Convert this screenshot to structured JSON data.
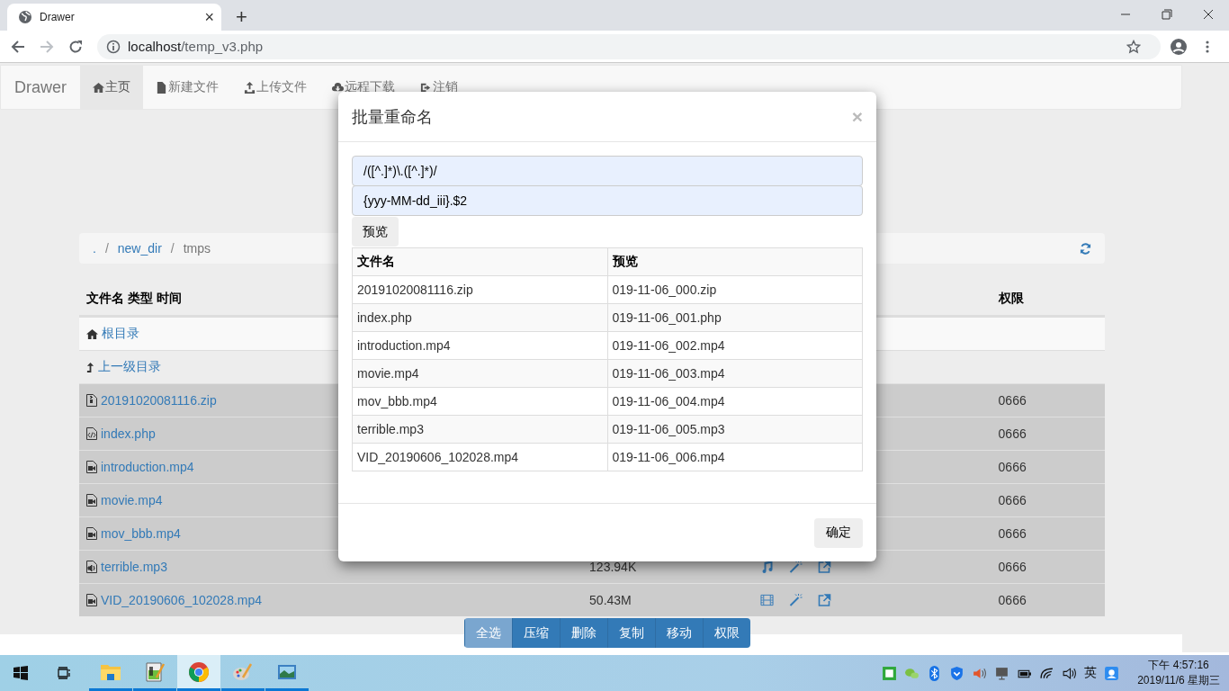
{
  "browser": {
    "tab": {
      "title": "Drawer",
      "close": "×"
    },
    "new_tab": "+",
    "url": {
      "host": "localhost",
      "path": "/temp_v3.php"
    },
    "forward_disabled": true
  },
  "navbar": {
    "brand": "Drawer",
    "items": [
      {
        "kind": "home",
        "label": "主页",
        "selected": true
      },
      {
        "kind": "file",
        "label": "新建文件",
        "selected": false
      },
      {
        "kind": "upload",
        "label": "上传文件",
        "selected": false
      },
      {
        "kind": "download",
        "label": "远程下载",
        "selected": false
      },
      {
        "kind": "logout",
        "label": "注销",
        "selected": false
      }
    ]
  },
  "breadcrumb": [
    {
      "label": ".",
      "current": false,
      "separator": "/"
    },
    {
      "label": "new_dir",
      "current": false,
      "separator": "/"
    },
    {
      "label": "tmps",
      "current": true
    }
  ],
  "file_table": {
    "header": {
      "name": "文件名 类型 时间",
      "permissions": "权限"
    },
    "nav_rows": [
      {
        "kind": "root",
        "label": "根目录"
      },
      {
        "kind": "up",
        "label": "上一级目录"
      }
    ],
    "rows": [
      {
        "kind": "zip",
        "name": "20191020081116.zip",
        "selected": true,
        "permissions": "0666"
      },
      {
        "kind": "code",
        "name": "index.php",
        "selected": true,
        "permissions": "0666"
      },
      {
        "kind": "video",
        "name": "introduction.mp4",
        "selected": true,
        "permissions": "0666"
      },
      {
        "kind": "video",
        "name": "movie.mp4",
        "selected": true,
        "permissions": "0666"
      },
      {
        "kind": "video",
        "name": "mov_bbb.mp4",
        "selected": true,
        "permissions": "0666"
      },
      {
        "kind": "audio",
        "name": "terrible.mp3",
        "selected": true,
        "size": "123.94K",
        "actions": [
          {
            "kind": "music"
          },
          {
            "kind": "rename"
          },
          {
            "kind": "open"
          }
        ],
        "permissions": "0666"
      },
      {
        "kind": "video",
        "name": "VID_20190606_102028.mp4",
        "selected": true,
        "size": "50.43M",
        "actions": [
          {
            "kind": "film"
          },
          {
            "kind": "rename"
          },
          {
            "kind": "open"
          }
        ],
        "permissions": "0666"
      }
    ]
  },
  "toolbar": [
    {
      "label": "全选",
      "disabled": true
    },
    {
      "label": "压缩",
      "disabled": false
    },
    {
      "label": "删除",
      "disabled": false
    },
    {
      "label": "复制",
      "disabled": false
    },
    {
      "label": "移动",
      "disabled": false
    },
    {
      "label": "权限",
      "disabled": false
    }
  ],
  "modal": {
    "title": "批量重命名",
    "close": "×",
    "inputs": [
      {
        "value": "/([^.]*)\\.([^.]*)/"
      },
      {
        "value": "{yyy-MM-dd_iii}.$2"
      }
    ],
    "preview_button": "预览",
    "columns": [
      "文件名",
      "预览"
    ],
    "rows": [
      {
        "name": "20191020081116.zip",
        "preview": "019-11-06_000.zip"
      },
      {
        "name": "index.php",
        "preview": "019-11-06_001.php"
      },
      {
        "name": "introduction.mp4",
        "preview": "019-11-06_002.mp4"
      },
      {
        "name": "movie.mp4",
        "preview": "019-11-06_003.mp4"
      },
      {
        "name": "mov_bbb.mp4",
        "preview": "019-11-06_004.mp4"
      },
      {
        "name": "terrible.mp3",
        "preview": "019-11-06_005.mp3"
      },
      {
        "name": "VID_20190606_102028.mp4",
        "preview": "019-11-06_006.mp4"
      }
    ],
    "ok_button": "确定"
  },
  "taskbar": {
    "apps": [
      {
        "kind": "folder",
        "active": false
      },
      {
        "kind": "notepad",
        "active": false
      },
      {
        "kind": "chrome",
        "active": true
      },
      {
        "kind": "paint",
        "active": false
      },
      {
        "kind": "photos",
        "active": false
      }
    ],
    "ime": "英",
    "time": "下午 4:57:16",
    "date": "2019/11/6 星期三"
  }
}
